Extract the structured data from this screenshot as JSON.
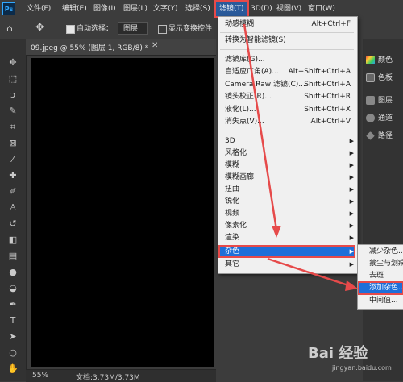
{
  "menubar": {
    "logo": "Ps",
    "items": [
      "文件(F)",
      "编辑(E)",
      "图像(I)",
      "图层(L)",
      "文字(Y)",
      "选择(S)",
      "滤镜(T)",
      "3D(D)",
      "视图(V)",
      "窗口(W)"
    ]
  },
  "options": {
    "auto_select_label": "自动选择：",
    "auto_select_value": "图层",
    "transform_label": "显示变换控件"
  },
  "document": {
    "tab_label": "09.jpeg @ 55% (图层 1, RGB/8) *",
    "zoom": "55%",
    "doc_info": "文档:3.73M/3.73M"
  },
  "panels": {
    "color": "颜色",
    "swatches": "色板",
    "layers": "图层",
    "channels": "通道",
    "paths": "路径"
  },
  "filter_menu": {
    "items": [
      {
        "label": "动感模糊",
        "shortcut": "Alt+Ctrl+F"
      },
      {
        "label": "转换为智能滤镜(S)",
        "shortcut": ""
      },
      {
        "label": "滤镜库(G)...",
        "shortcut": ""
      },
      {
        "label": "自适应广角(A)...",
        "shortcut": "Alt+Shift+Ctrl+A"
      },
      {
        "label": "Camera Raw 滤镜(C)...",
        "shortcut": "Shift+Ctrl+A"
      },
      {
        "label": "镜头校正(R)...",
        "shortcut": "Shift+Ctrl+R"
      },
      {
        "label": "液化(L)...",
        "shortcut": "Shift+Ctrl+X"
      },
      {
        "label": "消失点(V)...",
        "shortcut": "Alt+Ctrl+V"
      },
      {
        "label": "3D",
        "shortcut": ""
      },
      {
        "label": "风格化",
        "shortcut": ""
      },
      {
        "label": "模糊",
        "shortcut": ""
      },
      {
        "label": "模糊画廊",
        "shortcut": ""
      },
      {
        "label": "扭曲",
        "shortcut": ""
      },
      {
        "label": "锐化",
        "shortcut": ""
      },
      {
        "label": "视频",
        "shortcut": ""
      },
      {
        "label": "像素化",
        "shortcut": ""
      },
      {
        "label": "渲染",
        "shortcut": ""
      },
      {
        "label": "杂色",
        "shortcut": ""
      },
      {
        "label": "其它",
        "shortcut": ""
      }
    ]
  },
  "noise_submenu": {
    "items": [
      "减少杂色...",
      "蒙尘与划痕...",
      "去斑",
      "添加杂色...",
      "中间值..."
    ]
  },
  "watermark": {
    "text": "Bai 经验",
    "url": "jingyan.baidu.com"
  },
  "colors": {
    "highlight": "#1e6fd9",
    "annotation": "#e64a4a"
  }
}
